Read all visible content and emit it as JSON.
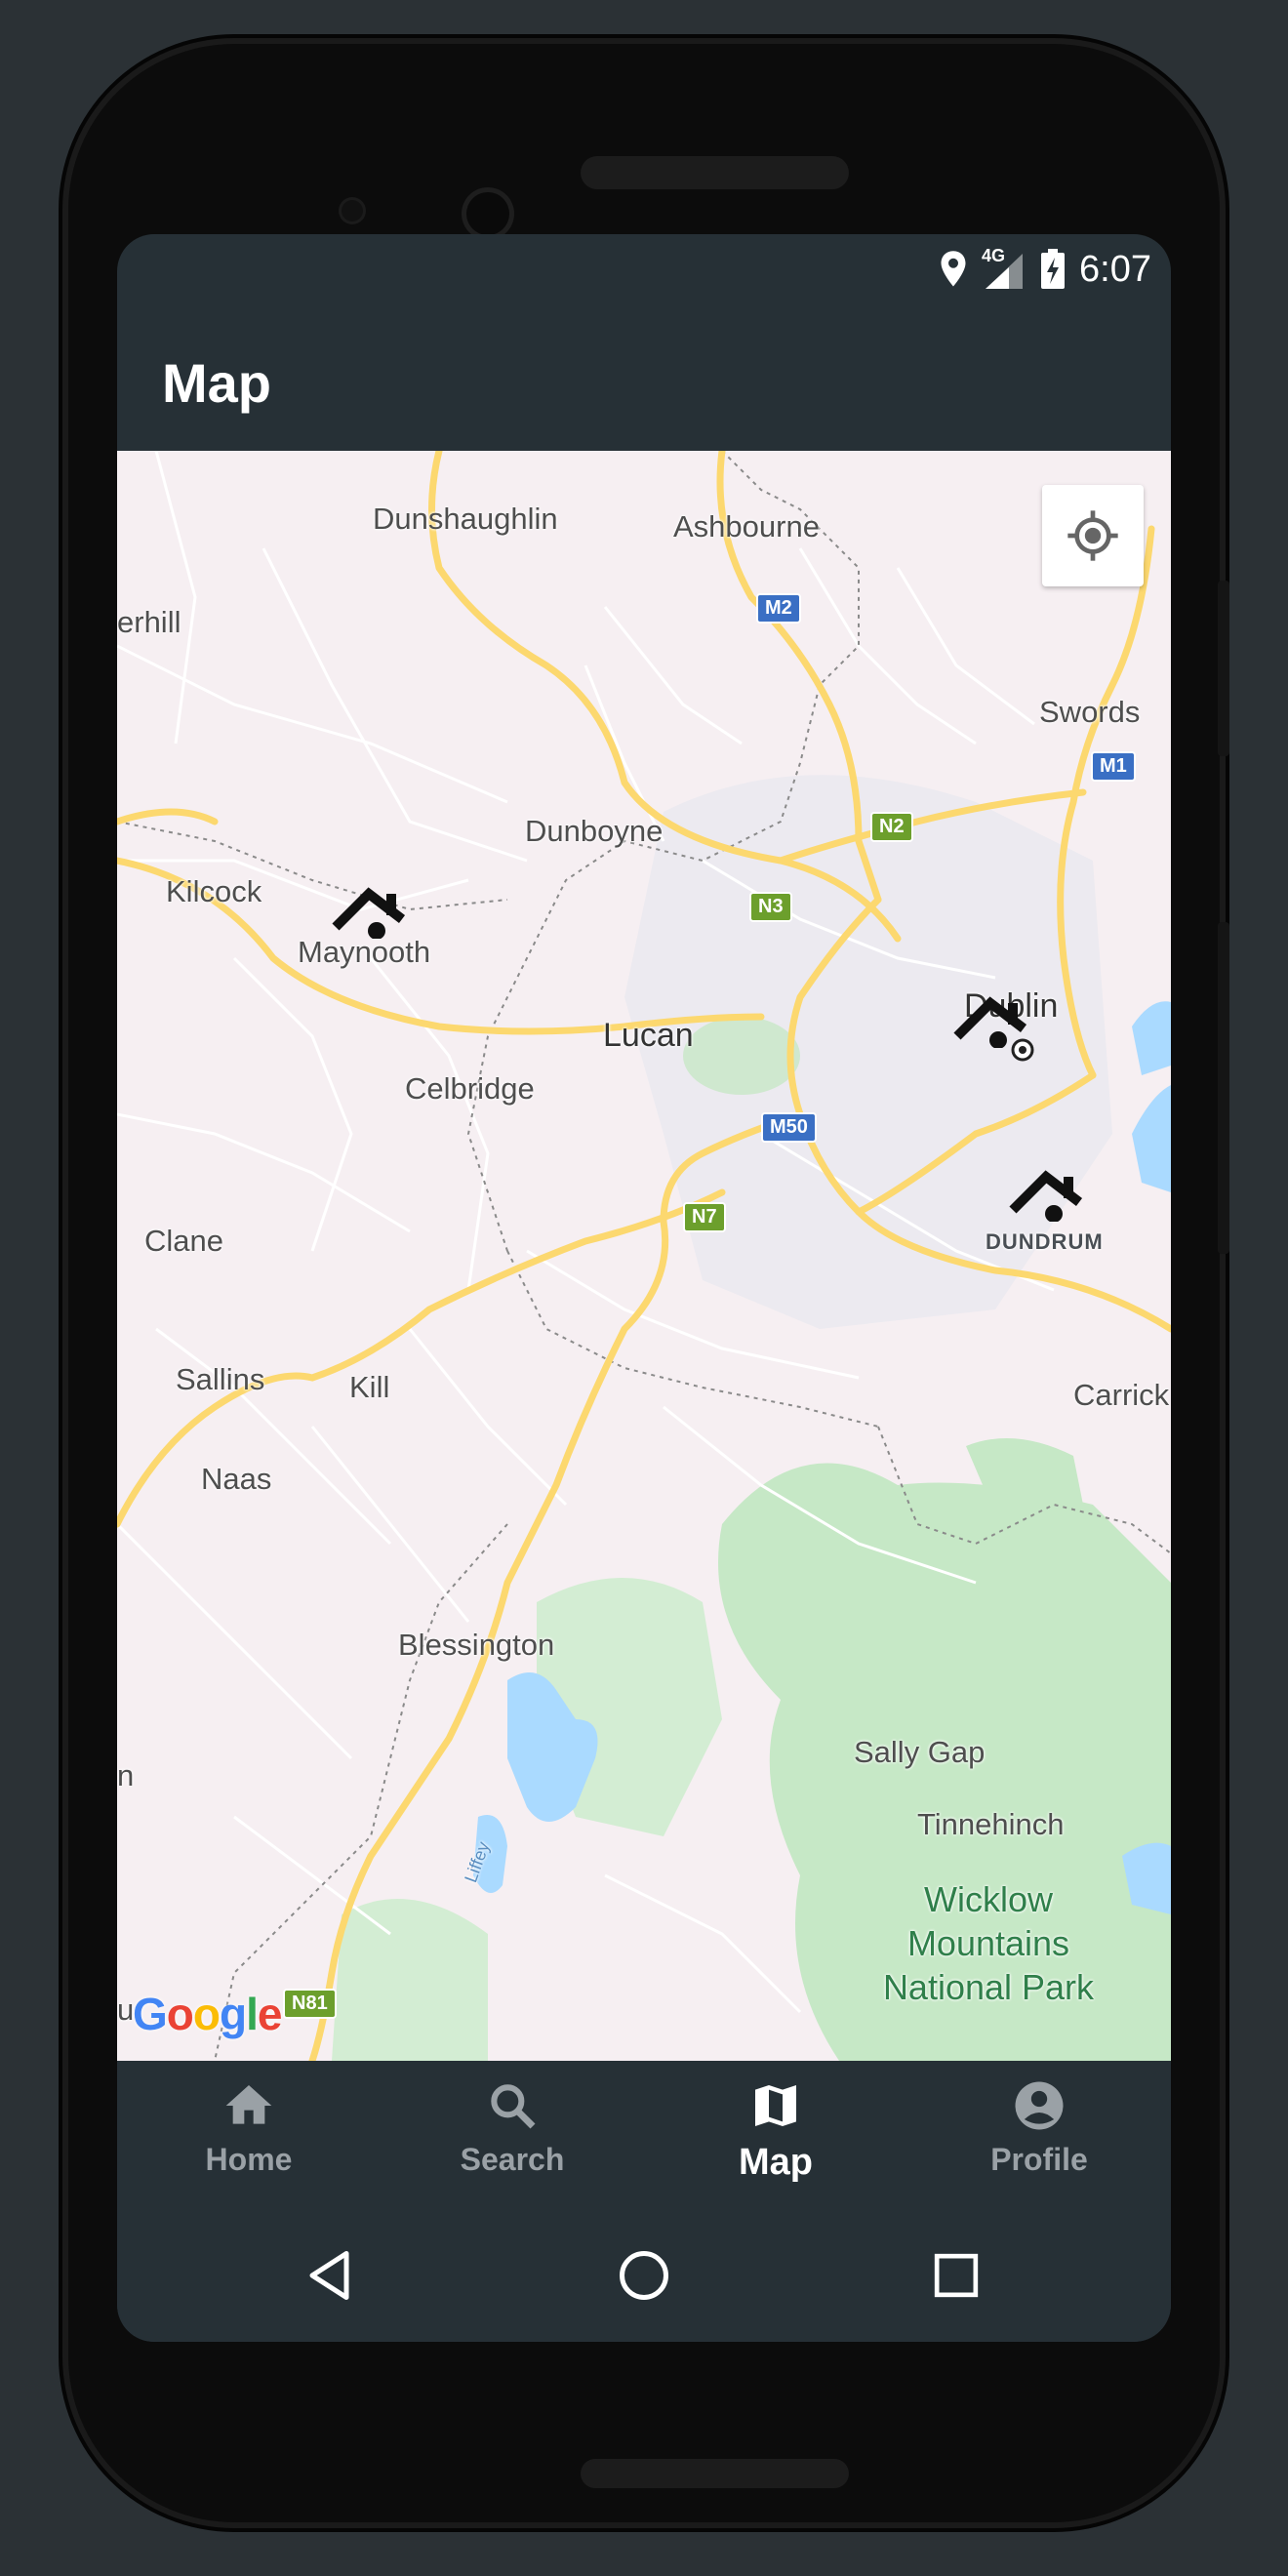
{
  "status_bar": {
    "time": "6:07",
    "network": "4G",
    "icons": [
      "location-icon",
      "signal-icon",
      "battery-charging-icon"
    ]
  },
  "app_bar": {
    "title": "Map"
  },
  "map": {
    "places": {
      "dunshaughlin": "Dunshaughlin",
      "ashbourne": "Ashbourne",
      "rathmolyon": "erhill",
      "swords": "Swords",
      "dunboyne": "Dunboyne",
      "kilcock": "Kilcock",
      "maynooth": "Maynooth",
      "dublin": "Dublin",
      "lucan": "Lucan",
      "celbridge": "Celbridge",
      "dundrum": "DUNDRUM",
      "clane": "Clane",
      "sallins": "Sallins",
      "kill": "Kill",
      "carrick": "Carrick",
      "naas": "Naas",
      "blessington": "Blessington",
      "sally_gap": "Sally Gap",
      "tinnehinch": "Tinnehinch",
      "wicklow_line1": "Wicklow",
      "wicklow_line2": "Mountains",
      "wicklow_line3": "National Park",
      "edge_n": "n",
      "edge_u": "u",
      "liffey": "Liffey"
    },
    "road_shields": {
      "m2": "M2",
      "m1": "M1",
      "n2": "N2",
      "n3": "N3",
      "m50": "M50",
      "n7": "N7",
      "n81": "N81"
    },
    "attribution": "Google",
    "markers": [
      "house-marker-icon",
      "house-marker-icon",
      "house-marker-icon"
    ],
    "locate_button_icon": "my-location-icon"
  },
  "bottom_nav": {
    "items": [
      {
        "label": "Home",
        "icon": "home-icon",
        "active": false
      },
      {
        "label": "Search",
        "icon": "search-icon",
        "active": false
      },
      {
        "label": "Map",
        "icon": "map-icon",
        "active": true
      },
      {
        "label": "Profile",
        "icon": "account-circle-icon",
        "active": false
      }
    ]
  },
  "system_nav": {
    "icons": [
      "back-icon",
      "home-circle-icon",
      "recents-icon"
    ]
  },
  "colors": {
    "app_background": "#263036",
    "map_land": "#f6eff2",
    "map_water": "#aadaff",
    "map_park": "#c6e8c6",
    "major_road": "#fcd86f",
    "nav_active": "#ffffff",
    "nav_inactive": "#9aa1a6"
  }
}
